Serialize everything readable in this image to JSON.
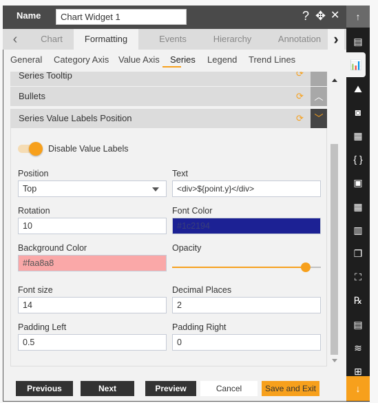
{
  "header": {
    "name_label": "Name",
    "widget_name": "Chart Widget 1",
    "help_icon": "?",
    "move_icon": "✥",
    "close_icon": "✕"
  },
  "tabs": [
    {
      "label": "Chart"
    },
    {
      "label": "Formatting",
      "active": true
    },
    {
      "label": "Events"
    },
    {
      "label": "Hierarchy"
    },
    {
      "label": "Annotation"
    }
  ],
  "subtabs": [
    {
      "label": "General"
    },
    {
      "label": "Category Axis"
    },
    {
      "label": "Value Axis"
    },
    {
      "label": "Series",
      "active": true
    },
    {
      "label": "Legend"
    },
    {
      "label": "Trend Lines"
    }
  ],
  "sections": [
    {
      "title": "Series Tooltip"
    },
    {
      "title": "Bullets"
    },
    {
      "title": "Series Value Labels Position"
    }
  ],
  "form": {
    "toggle_label": "Disable Value Labels",
    "toggle_on": true,
    "position_label": "Position",
    "position_value": "Top",
    "text_label": "Text",
    "text_value": "<div>${point.y}</div>",
    "rotation_label": "Rotation",
    "rotation_value": "10",
    "font_color_label": "Font Color",
    "font_color_value": "#1c2194",
    "bg_color_label": "Background Color",
    "bg_color_value": "#faa8a8",
    "opacity_label": "Opacity",
    "opacity_value": 0.9,
    "font_size_label": "Font size",
    "font_size_value": "14",
    "decimal_label": "Decimal Places",
    "decimal_value": "2",
    "padding_left_label": "Padding Left",
    "padding_left_value": "0.5",
    "padding_right_label": "Padding Right",
    "padding_right_value": "0"
  },
  "footer": {
    "previous": "Previous",
    "next": "Next",
    "preview": "Preview",
    "cancel": "Cancel",
    "save": "Save and Exit"
  },
  "colors": {
    "accent": "#f7a01c",
    "dark": "#333333"
  },
  "sidebar_icons": [
    "scroll-top-icon",
    "widget-icon",
    "chart-icon",
    "map-icon",
    "report-icon",
    "document-icon",
    "code-braces-icon",
    "image-icon",
    "pivot-icon",
    "kpi-chart-icon",
    "copy-icon",
    "cubes-icon",
    "rx-formula-icon",
    "save-file-icon",
    "layers-icon",
    "grid-icon",
    "scroll-bottom-icon"
  ]
}
